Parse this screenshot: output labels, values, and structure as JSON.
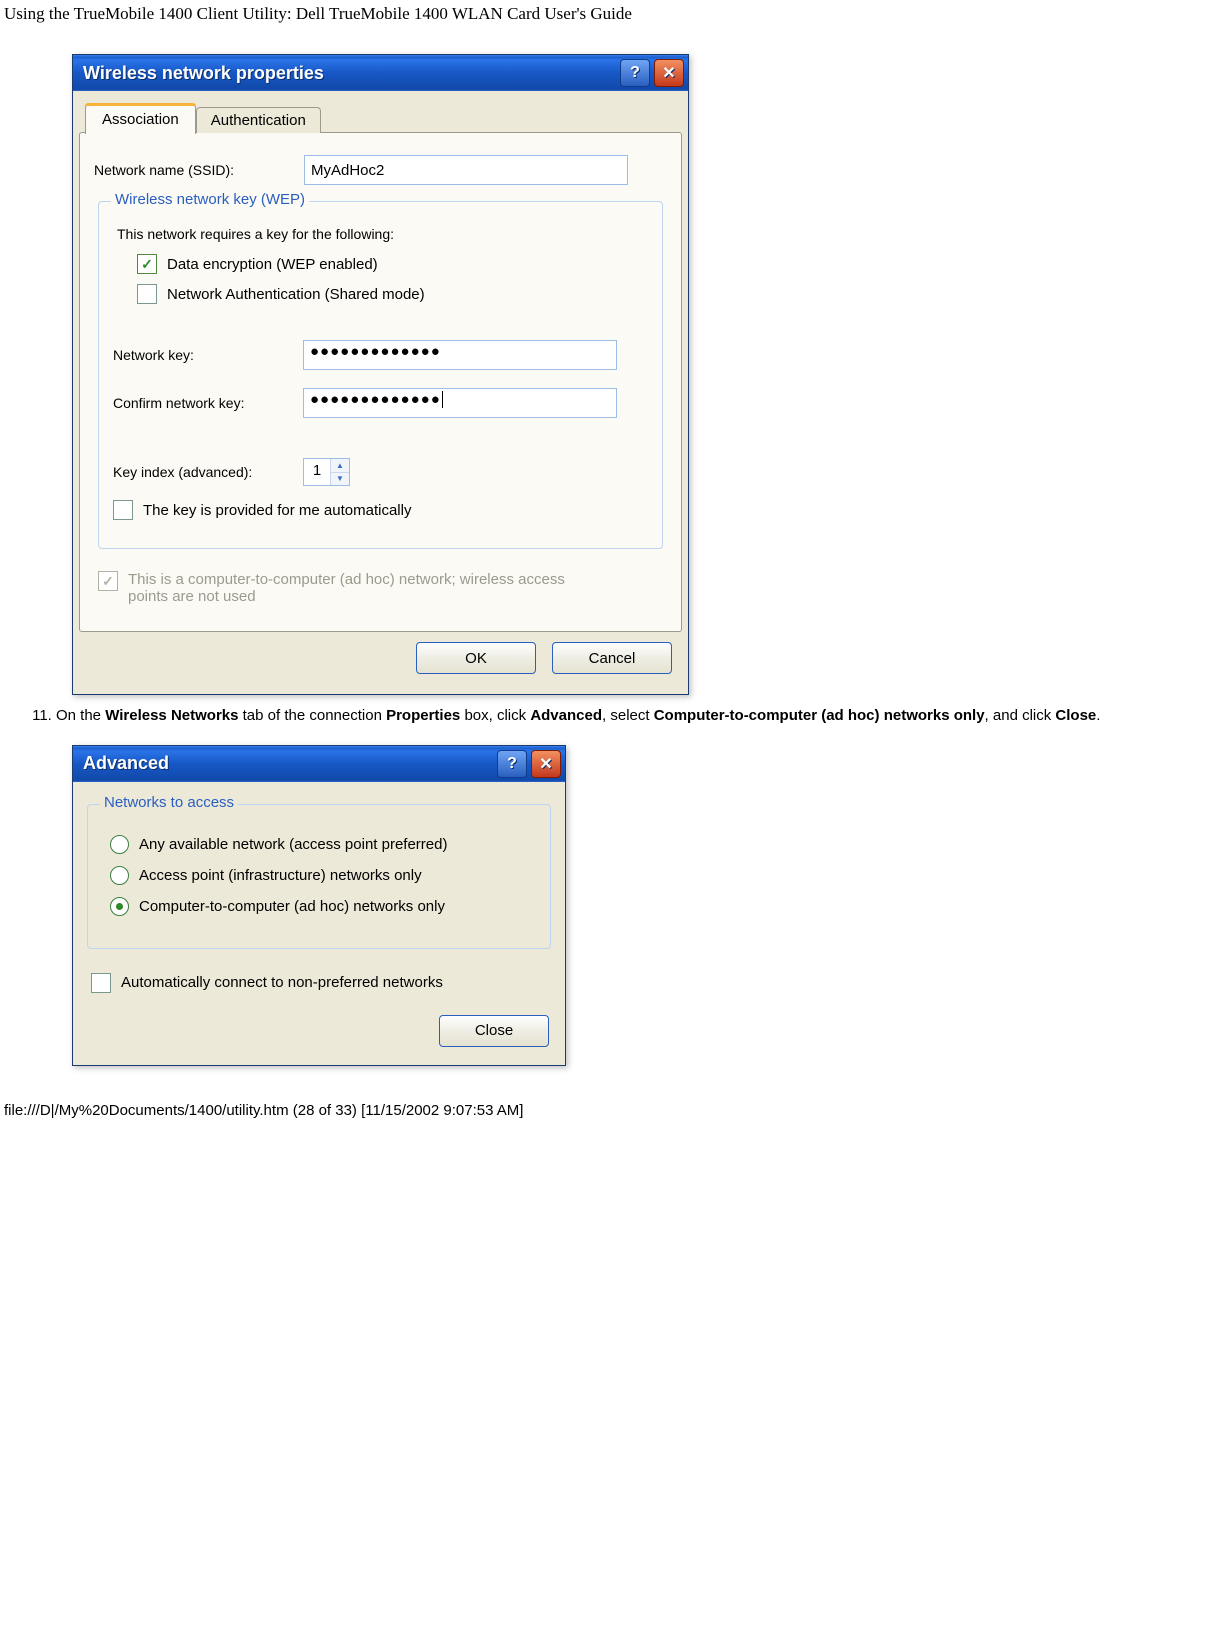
{
  "page": {
    "title": "Using the TrueMobile 1400 Client Utility: Dell TrueMobile 1400 WLAN Card User's Guide",
    "footer": "file:///D|/My%20Documents/1400/utility.htm (28 of 33) [11/15/2002 9:07:53 AM]"
  },
  "dialog1": {
    "title": "Wireless network properties",
    "tabs": {
      "assoc": "Association",
      "auth": "Authentication"
    },
    "ssid_label": "Network name (SSID):",
    "ssid_value": "MyAdHoc2",
    "wep_legend": "Wireless network key (WEP)",
    "wep_intro": "This network requires a key for the following:",
    "data_enc": "Data encryption (WEP enabled)",
    "net_auth": "Network Authentication (Shared mode)",
    "nkey_label": "Network key:",
    "nkey_value": "●●●●●●●●●●●●●",
    "ckey_label": "Confirm network key:",
    "ckey_value": "●●●●●●●●●●●●●",
    "keyidx_label": "Key index (advanced):",
    "keyidx_value": "1",
    "autokey": "The key is provided for me automatically",
    "adhoc": "This is a computer-to-computer (ad hoc) network; wireless access points are not used",
    "ok": "OK",
    "cancel": "Cancel"
  },
  "step11": {
    "number": "11.",
    "t1": "On the ",
    "b1": "Wireless Networks",
    "t2": " tab of the connection ",
    "b2": "Properties",
    "t3": " box, click ",
    "b3": "Advanced",
    "t4": ", select ",
    "b4": "Computer-to-computer (ad hoc) networks only",
    "t5": ", and click ",
    "b5": "Close",
    "t6": "."
  },
  "dialog2": {
    "title": "Advanced",
    "legend": "Networks to access",
    "opt1": "Any available network (access point preferred)",
    "opt2": "Access point (infrastructure) networks only",
    "opt3": "Computer-to-computer (ad hoc) networks only",
    "autoconn": "Automatically connect to non-preferred networks",
    "close": "Close"
  }
}
